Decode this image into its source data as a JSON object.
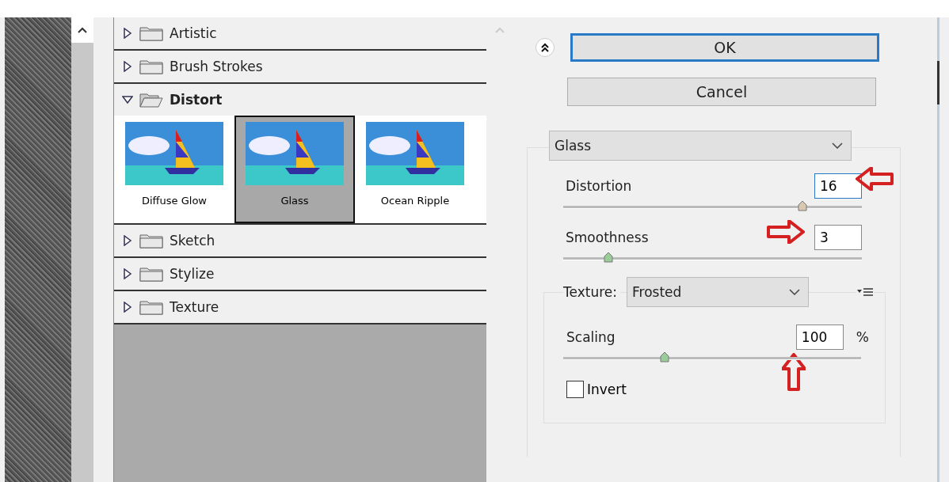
{
  "filter_categories": [
    {
      "label": "Artistic",
      "expanded": false
    },
    {
      "label": "Brush Strokes",
      "expanded": false
    },
    {
      "label": "Distort",
      "expanded": true,
      "filters": [
        {
          "label": "Diffuse Glow",
          "selected": false
        },
        {
          "label": "Glass",
          "selected": true
        },
        {
          "label": "Ocean Ripple",
          "selected": false
        }
      ]
    },
    {
      "label": "Sketch",
      "expanded": false
    },
    {
      "label": "Stylize",
      "expanded": false
    },
    {
      "label": "Texture",
      "expanded": false
    }
  ],
  "buttons": [
    {
      "label": "OK",
      "default": true
    },
    {
      "label": "Cancel",
      "default": false
    }
  ],
  "filter_dropdown": {
    "value": "Glass"
  },
  "settings": [
    {
      "label": "Distortion",
      "value": "16",
      "focused": true,
      "level": 0.8
    },
    {
      "label": "Smoothness",
      "value": "3",
      "focused": false,
      "level": 0.15
    }
  ],
  "texture": {
    "label": "Texture:",
    "value": "Frosted",
    "settings": [
      {
        "label": "Scaling",
        "value": "100",
        "unit": "%",
        "focused": false,
        "level": 0.34
      }
    ],
    "invert": {
      "label": "Invert",
      "checked": false
    }
  }
}
